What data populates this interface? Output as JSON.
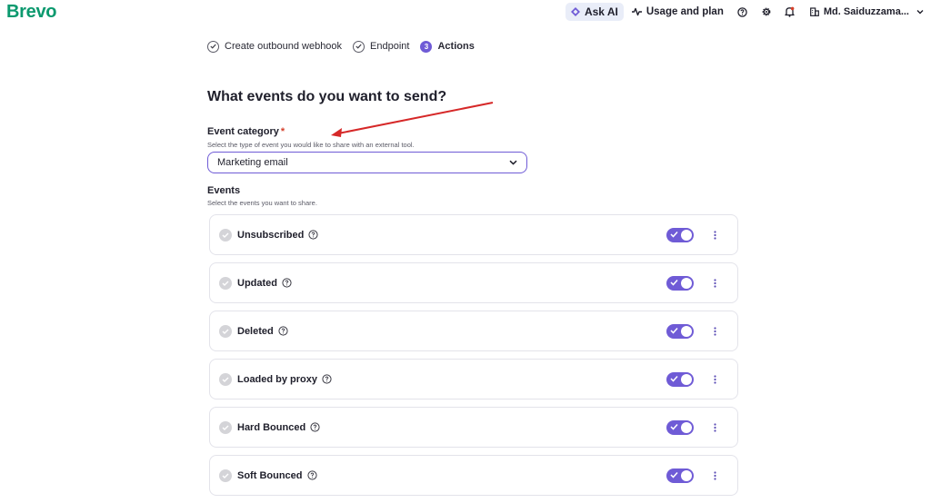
{
  "app": {
    "logo": "Brevo"
  },
  "topbar": {
    "ask_ai": "Ask AI",
    "usage": "Usage and plan",
    "user": "Md. Saiduzzama..."
  },
  "stepper": [
    {
      "label": "Create outbound webhook",
      "state": "done"
    },
    {
      "label": "Endpoint",
      "state": "done"
    },
    {
      "number": "3",
      "label": "Actions",
      "state": "active"
    }
  ],
  "main": {
    "title": "What events do you want to send?",
    "category": {
      "label": "Event category",
      "required_mark": "*",
      "helper": "Select the type of event you would like to share with an external tool.",
      "value": "Marketing email"
    },
    "events": {
      "label": "Events",
      "helper": "Select the events you want to share.",
      "items": [
        {
          "name": "Unsubscribed",
          "enabled": true
        },
        {
          "name": "Updated",
          "enabled": true
        },
        {
          "name": "Deleted",
          "enabled": true
        },
        {
          "name": "Loaded by proxy",
          "enabled": true
        },
        {
          "name": "Hard Bounced",
          "enabled": true
        },
        {
          "name": "Soft Bounced",
          "enabled": true
        }
      ]
    }
  },
  "colors": {
    "brand": "#0b996e",
    "accent": "#6f5bd6",
    "annotation": "#d62828"
  }
}
